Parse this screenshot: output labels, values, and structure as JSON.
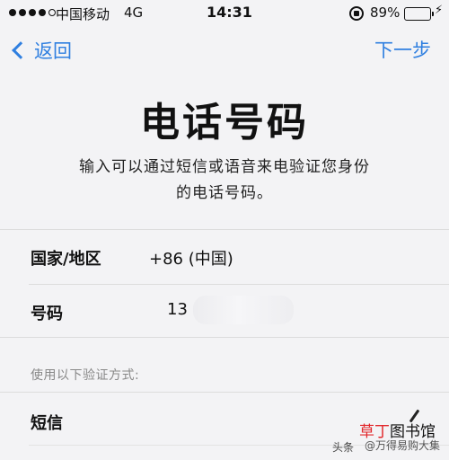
{
  "status_bar": {
    "carrier": "中国移动",
    "network": "4G",
    "time": "14:31",
    "battery_percent": "89%",
    "battery_level": 0.89,
    "battery_color": "#4cd964",
    "icons": [
      "signal-dots",
      "rotation-lock-icon",
      "battery-icon",
      "charging-icon"
    ]
  },
  "nav": {
    "back_label": "返回",
    "next_label": "下一步",
    "accent_color": "#2f7fe0"
  },
  "title": "电话号码",
  "description": {
    "line1": "输入可以通过短信或语音来电验证您身份",
    "line2": "的电话号码。"
  },
  "form": {
    "country_label": "国家/地区",
    "country_value": "+86 (中国)",
    "number_label": "号码",
    "number_value": "13"
  },
  "verification": {
    "header": "使用以下验证方式:",
    "sms_label": "短信"
  },
  "watermark": {
    "brand_part1": "草丁",
    "brand_part2": "图书馆",
    "prefix": "头条",
    "credit": "@万得易购大集"
  }
}
